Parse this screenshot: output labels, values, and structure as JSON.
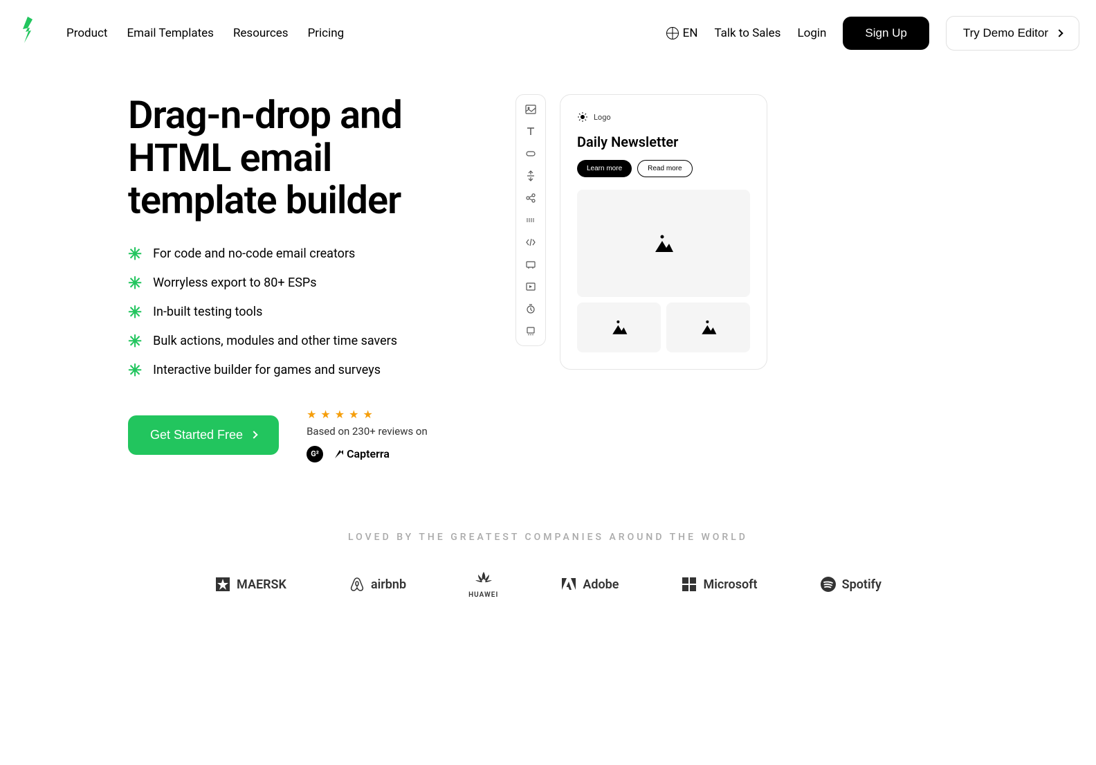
{
  "nav": {
    "items": [
      "Product",
      "Email Templates",
      "Resources",
      "Pricing"
    ]
  },
  "header": {
    "lang": "EN",
    "talk_to_sales": "Talk to Sales",
    "login": "Login",
    "signup": "Sign Up",
    "try_demo": "Try Demo Editor"
  },
  "hero": {
    "title": "Drag-n-drop and HTML email template builder",
    "features": [
      "For code and no-code email creators",
      "Worryless export to 80+ ESPs",
      "In-built testing tools",
      "Bulk actions, modules and other time savers",
      "Interactive builder for games and surveys"
    ],
    "cta": "Get Started Free",
    "reviews_text": "Based on 230+ reviews on",
    "capterra": "Capterra"
  },
  "preview": {
    "logo_text": "Logo",
    "title": "Daily Newsletter",
    "btn1": "Learn more",
    "btn2": "Read more"
  },
  "companies": {
    "title": "LOVED BY THE GREATEST COMPANIES AROUND THE WORLD",
    "logos": [
      "MAERSK",
      "airbnb",
      "HUAWEI",
      "Adobe",
      "Microsoft",
      "Spotify"
    ]
  }
}
